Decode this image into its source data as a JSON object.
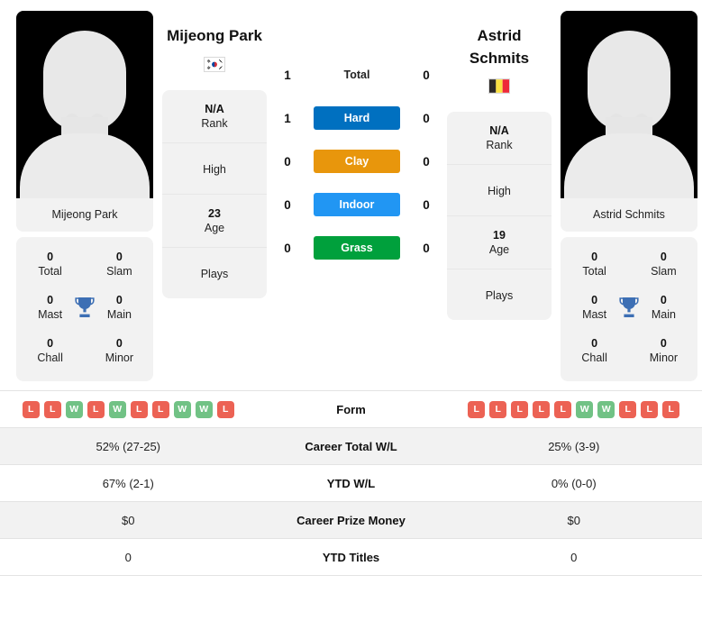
{
  "colors": {
    "win": "#71C285",
    "loss": "#EC6254",
    "hard": "#0070C0",
    "clay": "#E8960C",
    "indoor": "#2196F3",
    "grass": "#00A03C",
    "trophy": "#3D6FB4"
  },
  "players": {
    "left": {
      "name": "Mijeong Park",
      "caption": "Mijeong Park",
      "flag": "south-korea-flag",
      "rank_value": "N/A",
      "rank_label": "Rank",
      "high_label": "High",
      "age_value": "23",
      "age_label": "Age",
      "plays_label": "Plays",
      "titles": [
        {
          "value": "0",
          "label": "Total"
        },
        {
          "value": "0",
          "label": "Slam"
        },
        {
          "value": "0",
          "label": "Mast"
        },
        {
          "value": "0",
          "label": "Main"
        },
        {
          "value": "0",
          "label": "Chall"
        },
        {
          "value": "0",
          "label": "Minor"
        }
      ],
      "form": [
        "L",
        "L",
        "W",
        "L",
        "W",
        "L",
        "L",
        "W",
        "W",
        "L"
      ]
    },
    "right": {
      "name": "Astrid Schmits",
      "caption": "Astrid Schmits",
      "flag": "belgium-flag",
      "rank_value": "N/A",
      "rank_label": "Rank",
      "high_label": "High",
      "age_value": "19",
      "age_label": "Age",
      "plays_label": "Plays",
      "titles": [
        {
          "value": "0",
          "label": "Total"
        },
        {
          "value": "0",
          "label": "Slam"
        },
        {
          "value": "0",
          "label": "Mast"
        },
        {
          "value": "0",
          "label": "Main"
        },
        {
          "value": "0",
          "label": "Chall"
        },
        {
          "value": "0",
          "label": "Minor"
        }
      ],
      "form": [
        "L",
        "L",
        "L",
        "L",
        "L",
        "W",
        "W",
        "L",
        "L",
        "L"
      ]
    }
  },
  "surfaces": [
    {
      "label": "Total",
      "left": "1",
      "right": "0",
      "style": "plain"
    },
    {
      "label": "Hard",
      "left": "1",
      "right": "0",
      "style": "hard"
    },
    {
      "label": "Clay",
      "left": "0",
      "right": "0",
      "style": "clay"
    },
    {
      "label": "Indoor",
      "left": "0",
      "right": "0",
      "style": "indoor"
    },
    {
      "label": "Grass",
      "left": "0",
      "right": "0",
      "style": "grass"
    }
  ],
  "table": {
    "form_label": "Form",
    "rows": [
      {
        "label": "Career Total W/L",
        "left": "52% (27-25)",
        "right": "25% (3-9)"
      },
      {
        "label": "YTD W/L",
        "left": "67% (2-1)",
        "right": "0% (0-0)"
      },
      {
        "label": "Career Prize Money",
        "left": "$0",
        "right": "$0"
      },
      {
        "label": "YTD Titles",
        "left": "0",
        "right": "0"
      }
    ]
  }
}
